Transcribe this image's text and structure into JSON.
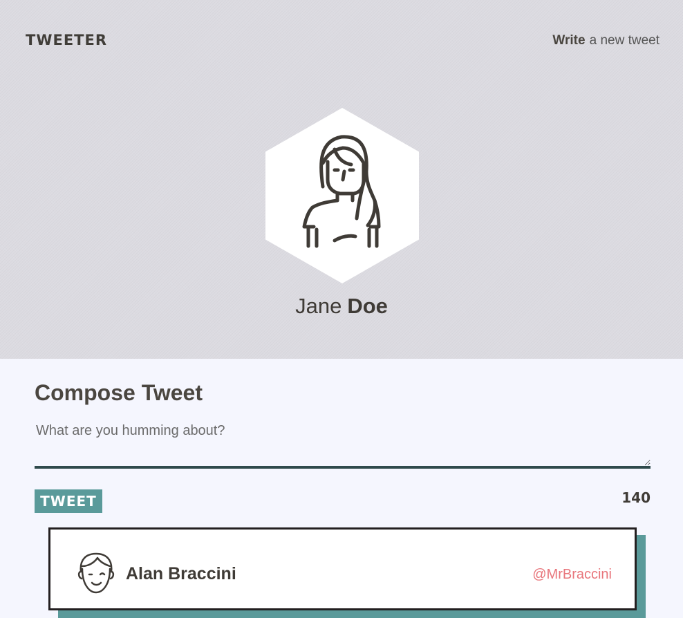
{
  "header": {
    "logo": "TWEETER",
    "write_link": {
      "bold": "Write",
      "rest": "a new tweet"
    }
  },
  "profile": {
    "avatar_icon": "woman-avatar-icon",
    "first_name": "Jane",
    "last_name": "Doe"
  },
  "compose": {
    "title": "Compose Tweet",
    "placeholder": "What are you humming about?",
    "button_label": "TWEET",
    "char_count": "140"
  },
  "tweets": [
    {
      "avatar_icon": "man-avatar-icon",
      "author": "Alan Braccini",
      "handle": "@MrBraccini"
    }
  ],
  "colors": {
    "header_bg": "#dcdbe1",
    "page_bg": "#f5f6fe",
    "accent": "#5a9a9a",
    "divider": "#2f4a4c",
    "handle": "#e8757b",
    "text": "#4a4640"
  }
}
